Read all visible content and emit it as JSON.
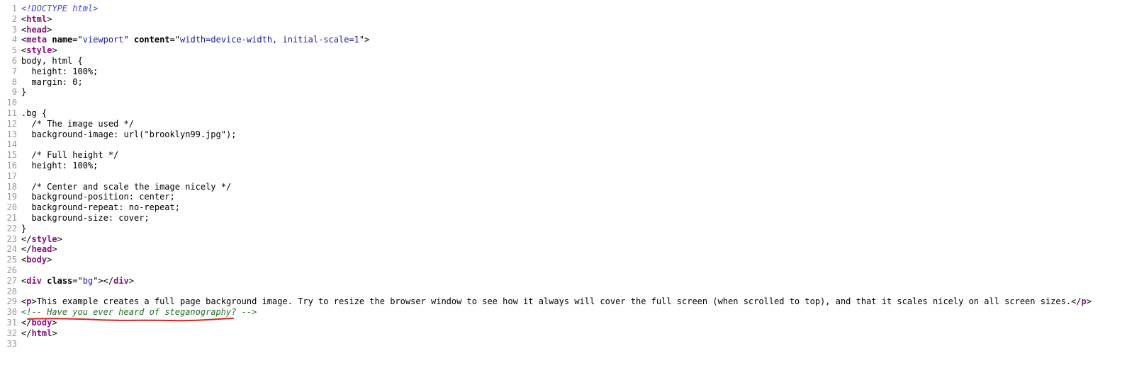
{
  "source_lines": [
    {
      "num": "1",
      "segments": [
        {
          "t": "doctype",
          "v": "<!DOCTYPE html>"
        }
      ]
    },
    {
      "num": "2",
      "segments": [
        {
          "t": "plain",
          "v": "<"
        },
        {
          "t": "tag",
          "v": "html"
        },
        {
          "t": "plain",
          "v": ">"
        }
      ]
    },
    {
      "num": "3",
      "segments": [
        {
          "t": "plain",
          "v": "<"
        },
        {
          "t": "tag",
          "v": "head"
        },
        {
          "t": "plain",
          "v": ">"
        }
      ]
    },
    {
      "num": "4",
      "segments": [
        {
          "t": "plain",
          "v": "<"
        },
        {
          "t": "tag",
          "v": "meta"
        },
        {
          "t": "plain",
          "v": " "
        },
        {
          "t": "attr",
          "v": "name"
        },
        {
          "t": "plain",
          "v": "=\""
        },
        {
          "t": "val",
          "v": "viewport"
        },
        {
          "t": "plain",
          "v": "\" "
        },
        {
          "t": "attr",
          "v": "content"
        },
        {
          "t": "plain",
          "v": "=\""
        },
        {
          "t": "val",
          "v": "width=device-width, initial-scale=1"
        },
        {
          "t": "plain",
          "v": "\">"
        }
      ]
    },
    {
      "num": "5",
      "segments": [
        {
          "t": "plain",
          "v": "<"
        },
        {
          "t": "tag",
          "v": "style"
        },
        {
          "t": "plain",
          "v": ">"
        }
      ]
    },
    {
      "num": "6",
      "segments": [
        {
          "t": "plain",
          "v": "body, html {"
        }
      ]
    },
    {
      "num": "7",
      "segments": [
        {
          "t": "plain",
          "v": "  height: 100%;"
        }
      ]
    },
    {
      "num": "8",
      "segments": [
        {
          "t": "plain",
          "v": "  margin: 0;"
        }
      ]
    },
    {
      "num": "9",
      "segments": [
        {
          "t": "plain",
          "v": "}"
        }
      ]
    },
    {
      "num": "10",
      "segments": []
    },
    {
      "num": "11",
      "segments": [
        {
          "t": "plain",
          "v": ".bg {"
        }
      ]
    },
    {
      "num": "12",
      "segments": [
        {
          "t": "plain",
          "v": "  /* The image used */"
        }
      ]
    },
    {
      "num": "13",
      "segments": [
        {
          "t": "plain",
          "v": "  background-image: url(\"brooklyn99.jpg\");"
        }
      ]
    },
    {
      "num": "14",
      "segments": []
    },
    {
      "num": "15",
      "segments": [
        {
          "t": "plain",
          "v": "  /* Full height */"
        }
      ]
    },
    {
      "num": "16",
      "segments": [
        {
          "t": "plain",
          "v": "  height: 100%;"
        }
      ]
    },
    {
      "num": "17",
      "segments": []
    },
    {
      "num": "18",
      "segments": [
        {
          "t": "plain",
          "v": "  /* Center and scale the image nicely */"
        }
      ]
    },
    {
      "num": "19",
      "segments": [
        {
          "t": "plain",
          "v": "  background-position: center;"
        }
      ]
    },
    {
      "num": "20",
      "segments": [
        {
          "t": "plain",
          "v": "  background-repeat: no-repeat;"
        }
      ]
    },
    {
      "num": "21",
      "segments": [
        {
          "t": "plain",
          "v": "  background-size: cover;"
        }
      ]
    },
    {
      "num": "22",
      "segments": [
        {
          "t": "plain",
          "v": "}"
        }
      ]
    },
    {
      "num": "23",
      "segments": [
        {
          "t": "plain",
          "v": "</"
        },
        {
          "t": "tag",
          "v": "style"
        },
        {
          "t": "plain",
          "v": ">"
        }
      ]
    },
    {
      "num": "24",
      "segments": [
        {
          "t": "plain",
          "v": "</"
        },
        {
          "t": "tag",
          "v": "head"
        },
        {
          "t": "plain",
          "v": ">"
        }
      ]
    },
    {
      "num": "25",
      "segments": [
        {
          "t": "plain",
          "v": "<"
        },
        {
          "t": "tag",
          "v": "body"
        },
        {
          "t": "plain",
          "v": ">"
        }
      ]
    },
    {
      "num": "26",
      "segments": []
    },
    {
      "num": "27",
      "segments": [
        {
          "t": "plain",
          "v": "<"
        },
        {
          "t": "tag",
          "v": "div"
        },
        {
          "t": "plain",
          "v": " "
        },
        {
          "t": "attr",
          "v": "class"
        },
        {
          "t": "plain",
          "v": "=\""
        },
        {
          "t": "val",
          "v": "bg"
        },
        {
          "t": "plain",
          "v": "\"></"
        },
        {
          "t": "tag",
          "v": "div"
        },
        {
          "t": "plain",
          "v": ">"
        }
      ]
    },
    {
      "num": "28",
      "segments": []
    },
    {
      "num": "29",
      "segments": [
        {
          "t": "plain",
          "v": "<"
        },
        {
          "t": "tag",
          "v": "p"
        },
        {
          "t": "plain",
          "v": ">This example creates a full page background image. Try to resize the browser window to see how it always will cover the full screen (when scrolled to top), and that it scales nicely on all screen sizes.</"
        },
        {
          "t": "tag",
          "v": "p"
        },
        {
          "t": "plain",
          "v": ">"
        }
      ]
    },
    {
      "num": "30",
      "segments": [
        {
          "t": "comment",
          "v": "<!-- Have you ever heard of steganography? -->"
        }
      ]
    },
    {
      "num": "31",
      "segments": [
        {
          "t": "plain",
          "v": "</"
        },
        {
          "t": "tag",
          "v": "body"
        },
        {
          "t": "plain",
          "v": ">"
        }
      ]
    },
    {
      "num": "32",
      "segments": [
        {
          "t": "plain",
          "v": "</"
        },
        {
          "t": "tag",
          "v": "html"
        },
        {
          "t": "plain",
          "v": ">"
        }
      ]
    },
    {
      "num": "33",
      "segments": []
    }
  ],
  "colors": {
    "line_number": "#9a9a9a",
    "doctype": "#4a4ad0",
    "tag": "#881280",
    "attribute_value": "#1a1aa6",
    "comment": "#236e25",
    "annotation_underline": "#e0201c"
  }
}
